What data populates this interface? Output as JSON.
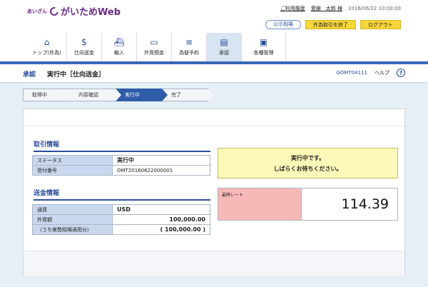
{
  "header": {
    "logo_small": "あいざん",
    "logo_text": "がいためWeb",
    "usage_history": "ご利用履歴",
    "user_name": "愛銀　太郎 様",
    "datetime": "2016/06/22 10:00:00",
    "buttons": {
      "public_rate": "公示相場",
      "end_fx": "外為取引を終了",
      "logout": "ログアウト"
    }
  },
  "nav": [
    {
      "label": "トップ(外為)",
      "icon": "home-icon",
      "glyph": "⌂"
    },
    {
      "label": "仕向送金",
      "icon": "remit-icon",
      "glyph": "$"
    },
    {
      "label": "輸入",
      "icon": "import-icon",
      "glyph": "⛴"
    },
    {
      "label": "外貨預金",
      "icon": "deposit-icon",
      "glyph": "▭"
    },
    {
      "label": "為替予約",
      "icon": "exchange-icon",
      "glyph": "≡"
    },
    {
      "label": "承認",
      "icon": "approve-icon",
      "glyph": "▤"
    },
    {
      "label": "各種管理",
      "icon": "manage-icon",
      "glyph": "▣"
    }
  ],
  "title": {
    "category": "承認",
    "main": "実行中［仕向送金］",
    "screen_code": "GOMT04111",
    "help": "ヘルプ"
  },
  "steps": [
    "取得中",
    "内容確認",
    "実行中",
    "完了"
  ],
  "transaction_info": {
    "title": "取引情報",
    "rows": [
      {
        "label": "ステータス",
        "value": "実行中"
      },
      {
        "label": "受付番号",
        "value": "OMT20160622000001"
      }
    ]
  },
  "remit_info": {
    "title": "送金情報",
    "rows": [
      {
        "label": "通貨",
        "value": "USD"
      },
      {
        "label": "外貨額",
        "value": "100,000.00"
      },
      {
        "label": "（うち実勢相場適用分）",
        "value": "( 100,000.00 )"
      }
    ]
  },
  "message": {
    "line1": "実行中です。",
    "line2": "しばらくお待ちください。"
  },
  "rate": {
    "label": "最終レート",
    "value": "114.39"
  },
  "colors": {
    "brand": "#6a2a8a",
    "accent": "#2a4d9a",
    "step_active": "#2f5ca8",
    "message_bg": "#fdf8b8",
    "rate_bg": "#f7b8b8"
  }
}
